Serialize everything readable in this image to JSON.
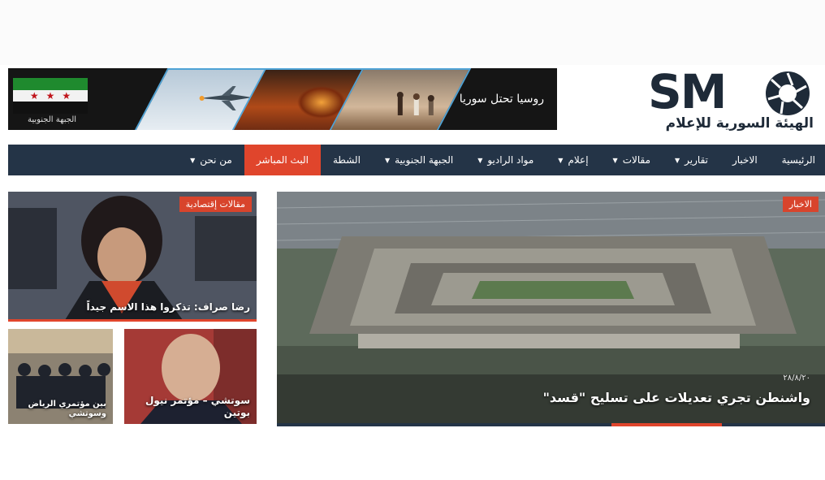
{
  "banner": {
    "title": "روسيا تحتل سوريا",
    "flag_caption": "الجبهة الجنوبية"
  },
  "logo": {
    "letters": "SM",
    "subtitle": "الهيئة السورية للإعلام"
  },
  "nav": [
    {
      "label": "الرئيسية",
      "dropdown": false
    },
    {
      "label": "الاخبار",
      "dropdown": false
    },
    {
      "label": "تقارير",
      "dropdown": true
    },
    {
      "label": "مقالات",
      "dropdown": true
    },
    {
      "label": "إعلام",
      "dropdown": true
    },
    {
      "label": "مواد الراديو",
      "dropdown": true
    },
    {
      "label": "الجبهة الجنوبية",
      "dropdown": true
    },
    {
      "label": "الشطة",
      "dropdown": false
    },
    {
      "label": "البث المباشر",
      "dropdown": false,
      "highlight": true
    },
    {
      "label": "من نحن",
      "dropdown": true
    }
  ],
  "feature": {
    "tag": "الاخبار",
    "date": "٢٨/٨/٢٠",
    "title": "واشنطن تجري تعديلات على تسليح \"قسد\""
  },
  "cards": [
    {
      "tag": "مقالات إقتصادية",
      "caption": "رضا صراف: تذكروا هذا الاسم جيداً"
    },
    {
      "caption": "سوتشي – مؤتمر نيول بوتين"
    },
    {
      "caption": "بين مؤتمري الرياض وسوتشي"
    }
  ],
  "colors": {
    "nav_bg": "#243447",
    "accent": "#e0452c",
    "logo": "#1e2a38"
  }
}
